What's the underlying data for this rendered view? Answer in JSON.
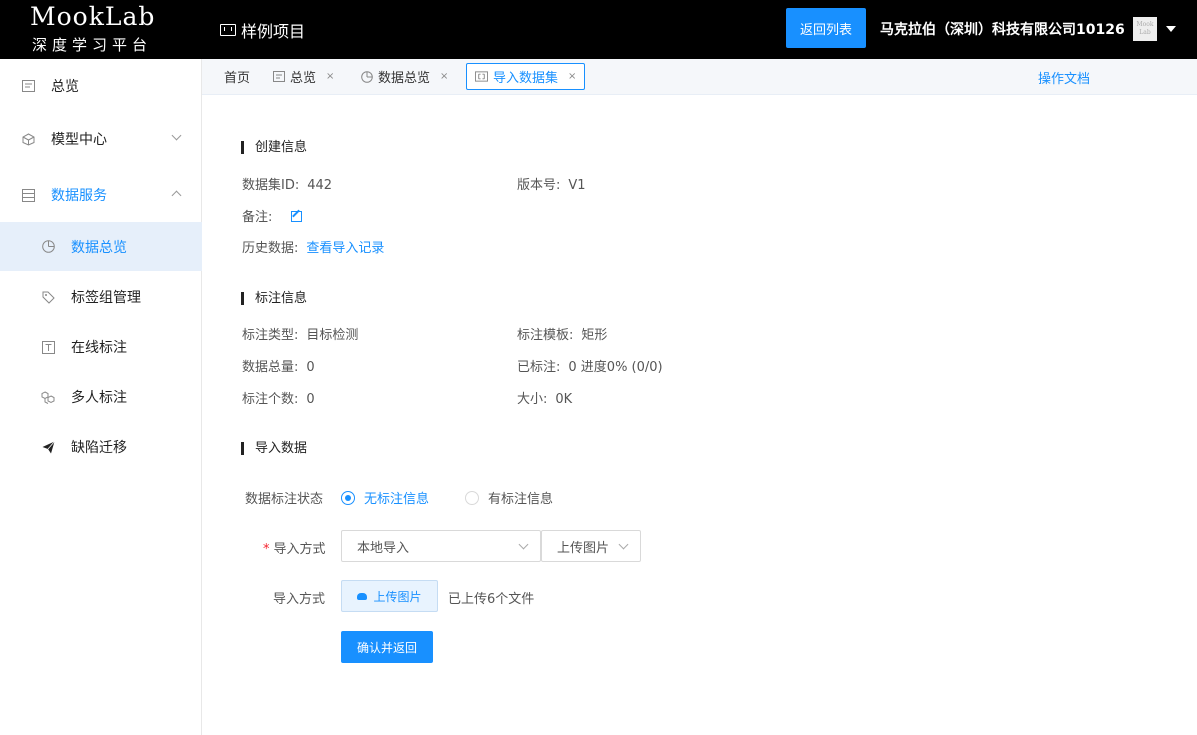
{
  "header": {
    "logo_main": "MookLab",
    "logo_sub": "深度学习平台",
    "project_name": "样例项目",
    "back_button": "返回列表",
    "company": "马克拉伯（深圳）科技有限公司10126",
    "avatar_text": "Mook Lab"
  },
  "sidebar": {
    "items": [
      {
        "label": "总览",
        "icon": "overview-icon"
      },
      {
        "label": "模型中心",
        "icon": "cube-icon"
      },
      {
        "label": "数据服务",
        "icon": "database-icon"
      },
      {
        "label": "数据总览",
        "icon": "pie-chart-icon"
      },
      {
        "label": "标签组管理",
        "icon": "tag-icon"
      },
      {
        "label": "在线标注",
        "icon": "text-icon"
      },
      {
        "label": "多人标注",
        "icon": "cubes-icon"
      },
      {
        "label": "缺陷迁移",
        "icon": "send-icon"
      }
    ]
  },
  "tabs": {
    "items": [
      {
        "label": "首页"
      },
      {
        "label": "总览",
        "close": "×"
      },
      {
        "label": "数据总览",
        "close": "×"
      },
      {
        "label": "导入数据集",
        "close": "×"
      }
    ],
    "doc_link": "操作文档"
  },
  "create_info": {
    "title": "创建信息",
    "dataset_id_label": "数据集ID:",
    "dataset_id": "442",
    "version_label": "版本号:",
    "version": "V1",
    "remark_label": "备注:",
    "history_label": "历史数据:",
    "history_link": "查看导入记录"
  },
  "annotation_info": {
    "title": "标注信息",
    "type_label": "标注类型:",
    "type": "目标检测",
    "template_label": "标注模板:",
    "template": "矩形",
    "total_label": "数据总量:",
    "total": "0",
    "annotated_label": "已标注:",
    "annotated": "0 进度0% (0/0)",
    "count_label": "标注个数:",
    "count": "0",
    "size_label": "大小:",
    "size": "0K"
  },
  "import_data": {
    "title": "导入数据",
    "status_label": "数据标注状态",
    "radio_options": [
      "无标注信息",
      "有标注信息"
    ],
    "selected_option": "无标注信息",
    "method_label": "导入方式",
    "method_value": "本地导入",
    "type_value": "上传图片",
    "method2_label": "导入方式",
    "upload_button": "上传图片",
    "upload_note": "已上传6个文件",
    "confirm_button": "确认并返回"
  },
  "colors": {
    "primary": "#1890ff",
    "topbar": "#000000",
    "selected_bg": "#e6effa"
  }
}
